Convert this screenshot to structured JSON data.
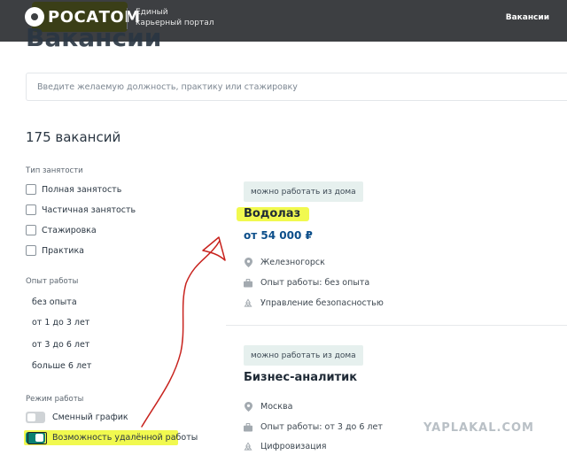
{
  "header": {
    "logo_text": "РОСАТОМ",
    "portal_line1": "Единый",
    "portal_line2": "карьерный портал",
    "nav_vacancies": "Вакансии"
  },
  "page": {
    "title": "Вакансии",
    "search_placeholder": "Введите желаемую должность, практику или стажировку",
    "count": "175 вакансий"
  },
  "filters": {
    "employment_title": "Тип занятости",
    "employment": [
      "Полная занятость",
      "Частичная занятость",
      "Стажировка",
      "Практика"
    ],
    "experience_title": "Опыт работы",
    "experience": [
      "без опыта",
      "от 1 до 3 лет",
      "от 3 до 6 лет",
      "больше 6 лет"
    ],
    "mode_title": "Режим работы",
    "shift_label": "Сменный график",
    "remote_label": "Возможность удалённой работы",
    "shift_on": false,
    "remote_on": true
  },
  "vacancies": [
    {
      "badge": "можно работать из дома",
      "title": "Водолаз",
      "salary": "от 54 000 ₽",
      "city": "Железногорск",
      "experience": "Опыт работы: без опыта",
      "department": "Управление безопасностью"
    },
    {
      "badge": "можно работать из дома",
      "title": "Бизнес-аналитик",
      "city": "Москва",
      "experience": "Опыт работы: от 3 до 6 лет",
      "department": "Цифровизация"
    }
  ],
  "watermark": "YAPLAKAL.COM",
  "colors": {
    "header_bg": "#3d3f42",
    "highlight": "#f0f83c",
    "toggle_on": "#0b8070",
    "salary": "#0c4e8a",
    "badge_bg": "#e6f0ee",
    "annotation_arrow": "#c8231e"
  },
  "icons": {
    "location": "location-pin-icon",
    "experience": "briefcase-icon",
    "department": "recycle-icon"
  }
}
